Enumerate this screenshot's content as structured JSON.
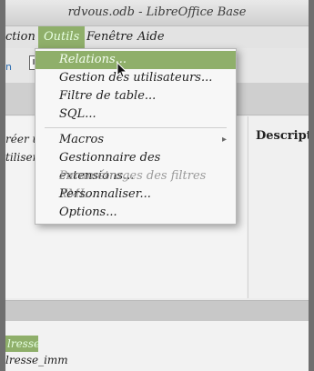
{
  "window": {
    "title": "rdvous.odb - LibreOffice Base"
  },
  "menubar": {
    "items": [
      {
        "label": "ction"
      },
      {
        "label": "Outils"
      },
      {
        "label": "Fenêtre"
      },
      {
        "label": "Aide"
      }
    ]
  },
  "toolbar": {
    "blue_text": "n"
  },
  "left_panel": {
    "lines": [
      "réer u",
      "tiliser"
    ]
  },
  "right_panel": {
    "header": "Descriptio"
  },
  "bottom": {
    "selected_row": "lresse",
    "row2": "lresse_imm"
  },
  "dropdown": {
    "items": [
      {
        "label": "Relations...",
        "state": "highlight"
      },
      {
        "label": "Gestion des utilisateurs...",
        "state": "normal"
      },
      {
        "label": "Filtre de table...",
        "state": "normal"
      },
      {
        "label": "SQL...",
        "state": "normal"
      },
      {
        "label": "Macros",
        "state": "normal",
        "submenu_icon": "submenu-arrow-icon"
      },
      {
        "label": "Gestionnaire des extensions...",
        "state": "normal"
      },
      {
        "label": "Paramétrages des filtres XML...",
        "state": "disabled"
      },
      {
        "label": "Personnaliser...",
        "state": "normal"
      },
      {
        "label": "Options...",
        "state": "normal"
      }
    ]
  },
  "colors": {
    "highlight": "#8faf6a",
    "menu_bg": "#f7f7f7"
  },
  "icons": {
    "cursor": "mouse-pointer-icon",
    "toolbar": "toolbar-icon"
  }
}
